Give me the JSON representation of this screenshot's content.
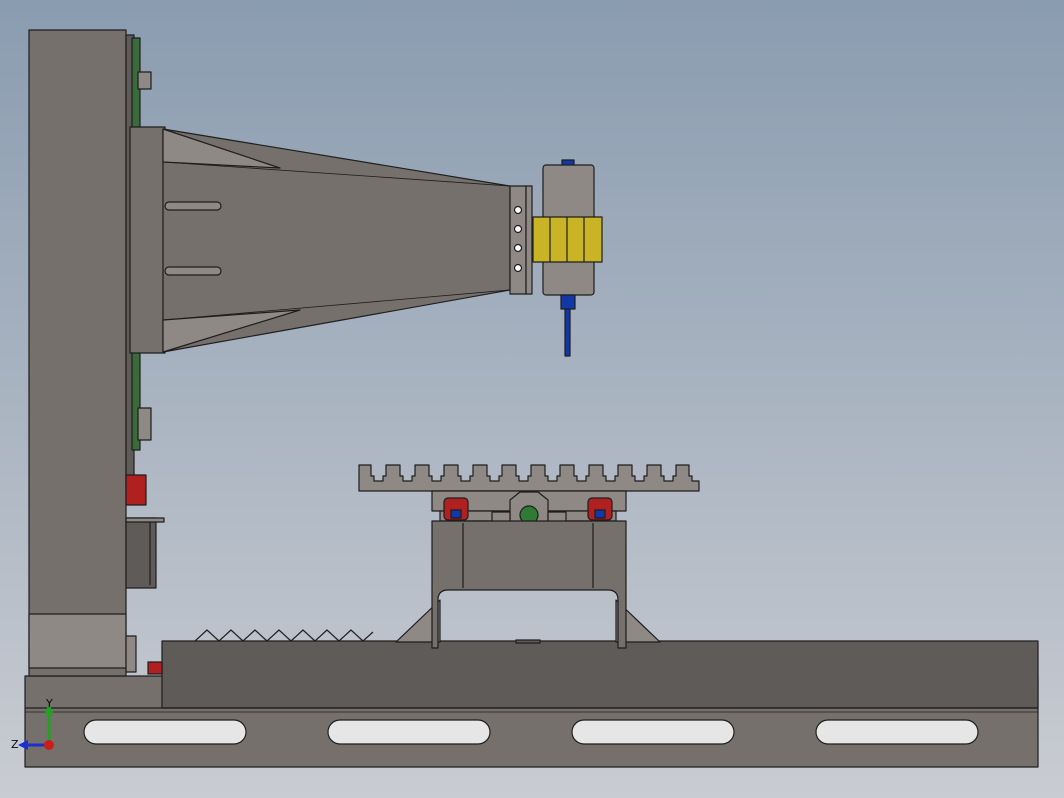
{
  "viewport": {
    "background_top": "#8a9cb0",
    "background_bottom": "#c9ccd2"
  },
  "colors": {
    "steel": "#75706c",
    "steel_light": "#8e8985",
    "steel_dark": "#5f5b58",
    "outline": "#1e1e1e",
    "brass": "#c9b425",
    "blue": "#1238a8",
    "red": "#b02020",
    "green": "#2f7a35",
    "pcb_green": "#3a6b3a",
    "slot_fill": "#e6e6e6"
  },
  "triad": {
    "x_label": "Z",
    "y_label": "Y",
    "x_color": "#1a2fd0",
    "y_color": "#22a022",
    "z_color": "#cc1d1d"
  }
}
